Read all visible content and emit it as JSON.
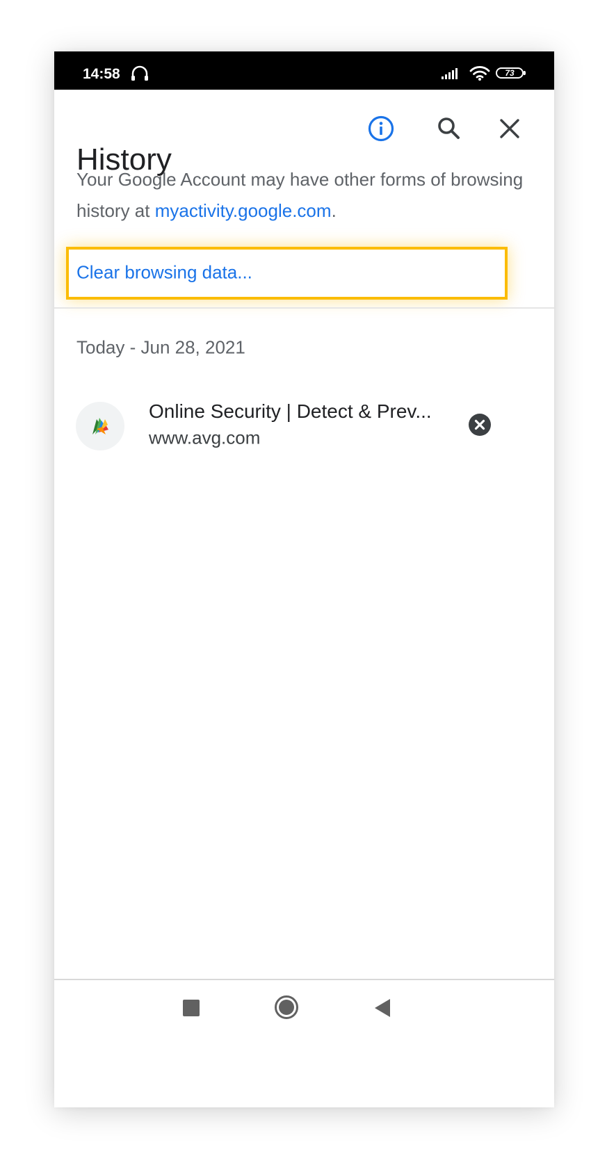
{
  "status_bar": {
    "time": "14:58",
    "battery": "73"
  },
  "header": {
    "title": "History",
    "icons": [
      "info-icon",
      "search-icon",
      "close-icon"
    ]
  },
  "account_note": {
    "text": "Your Google Account may have other forms of browsing history at ",
    "link": "myactivity.google.com",
    "suffix": "."
  },
  "clear_browsing_data": {
    "label": "Clear browsing data..."
  },
  "history": {
    "date_header": "Today - Jun 28, 2021",
    "items": [
      {
        "title": "Online Security | Detect & Prev...",
        "url": "www.avg.com",
        "favicon": "avg-favicon"
      }
    ]
  },
  "nav": {
    "icons": [
      "recents-icon",
      "home-icon",
      "back-icon"
    ]
  },
  "colors": {
    "accent": "#1a73e8",
    "highlight": "#fbbc04",
    "status_bar": "#000000",
    "text_primary": "#202124",
    "text_secondary": "#5f6368"
  }
}
